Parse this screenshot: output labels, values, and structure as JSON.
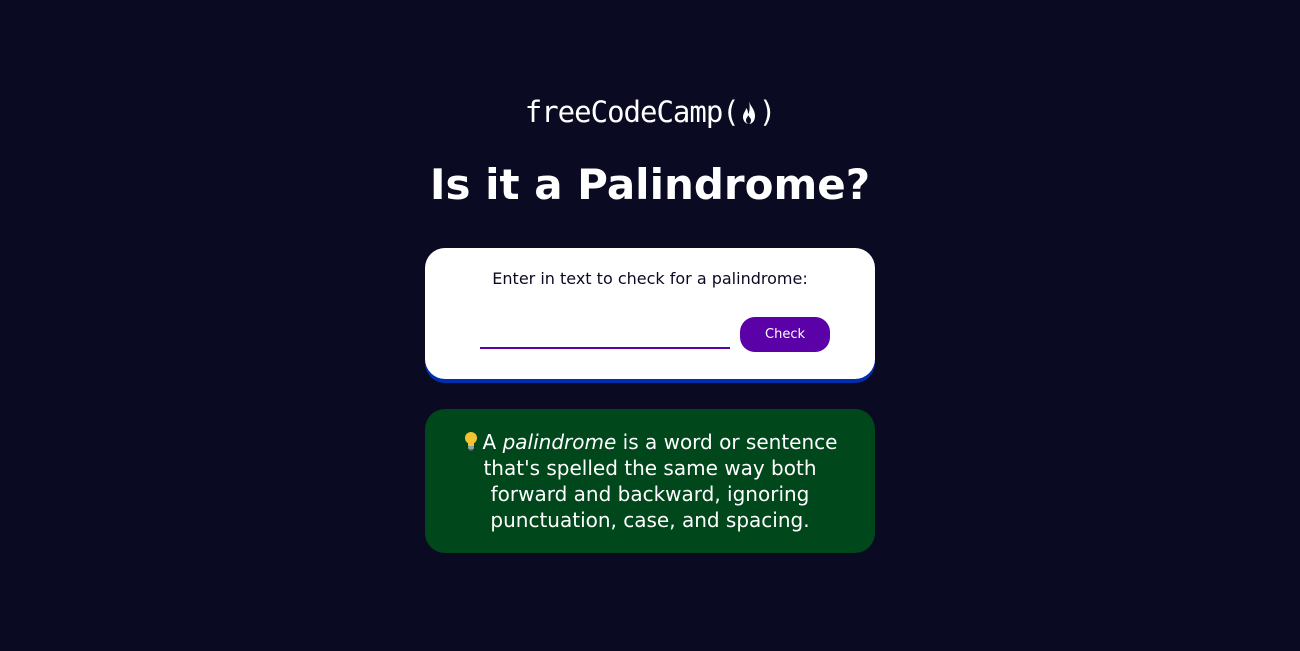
{
  "logo": {
    "prefix": "freeCodeCamp(",
    "suffix": ")",
    "icon": "fire-icon"
  },
  "title": "Is it a Palindrome?",
  "form": {
    "label": "Enter in text to check for a palindrome:",
    "input_value": "",
    "button_label": "Check"
  },
  "info": {
    "icon": "lightbulb-icon",
    "lead": "A",
    "term": "palindrome",
    "rest": "is a word or sentence that's spelled the same way both forward and backward, ignoring punctuation, case, and spacing."
  },
  "colors": {
    "background": "#0a0a23",
    "accent": "#5a01a7",
    "info_bg": "#00471b",
    "card_shadow": "#002ead"
  }
}
